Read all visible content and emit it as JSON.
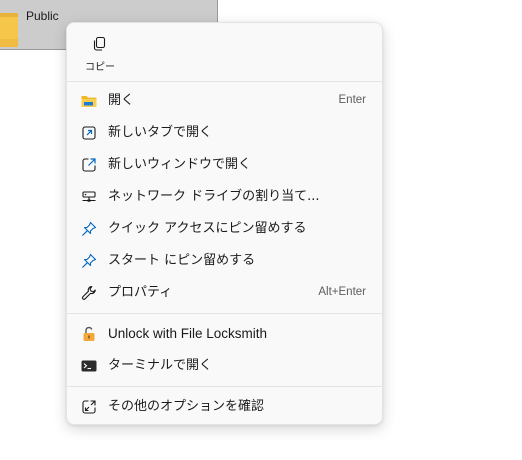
{
  "background": {
    "folder_label": "Public"
  },
  "context_menu": {
    "quick_actions": [
      {
        "label": "コピー",
        "icon": "copy-icon"
      }
    ],
    "groups": [
      [
        {
          "label": "開く",
          "shortcut": "Enter",
          "icon": "folder-open-icon"
        },
        {
          "label": "新しいタブで開く",
          "shortcut": "",
          "icon": "open-new-tab-icon"
        },
        {
          "label": "新しいウィンドウで開く",
          "shortcut": "",
          "icon": "open-new-window-icon"
        },
        {
          "label": "ネットワーク ドライブの割り当て...",
          "shortcut": "",
          "icon": "network-drive-icon"
        },
        {
          "label": "クイック アクセスにピン留めする",
          "shortcut": "",
          "icon": "pin-icon"
        },
        {
          "label": "スタート にピン留めする",
          "shortcut": "",
          "icon": "pin-icon"
        },
        {
          "label": "プロパティ",
          "shortcut": "Alt+Enter",
          "icon": "wrench-icon"
        }
      ],
      [
        {
          "label": "Unlock with File Locksmith",
          "shortcut": "",
          "icon": "unlock-icon"
        },
        {
          "label": "ターミナルで開く",
          "shortcut": "",
          "icon": "terminal-icon"
        }
      ],
      [
        {
          "label": "その他のオプションを確認",
          "shortcut": "",
          "icon": "more-options-icon"
        }
      ]
    ]
  },
  "colors": {
    "accent": "#0067c0",
    "folder_yellow": "#f7c948",
    "menu_background": "#f9f9f9",
    "selection_background": "#cccccc"
  }
}
